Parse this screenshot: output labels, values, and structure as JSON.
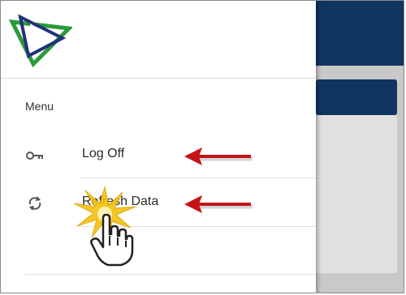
{
  "drawer": {
    "menu_title": "Menu",
    "items": [
      {
        "label": "Log Off",
        "icon": "key-icon"
      },
      {
        "label": "Refresh Data",
        "icon": "refresh-icon"
      }
    ]
  },
  "colors": {
    "header_navy": "#0f3560",
    "logo_green": "#2a9a3a",
    "logo_navy": "#22317a",
    "arrow_red": "#c4141a",
    "burst_yellow": "#f4c20d"
  }
}
